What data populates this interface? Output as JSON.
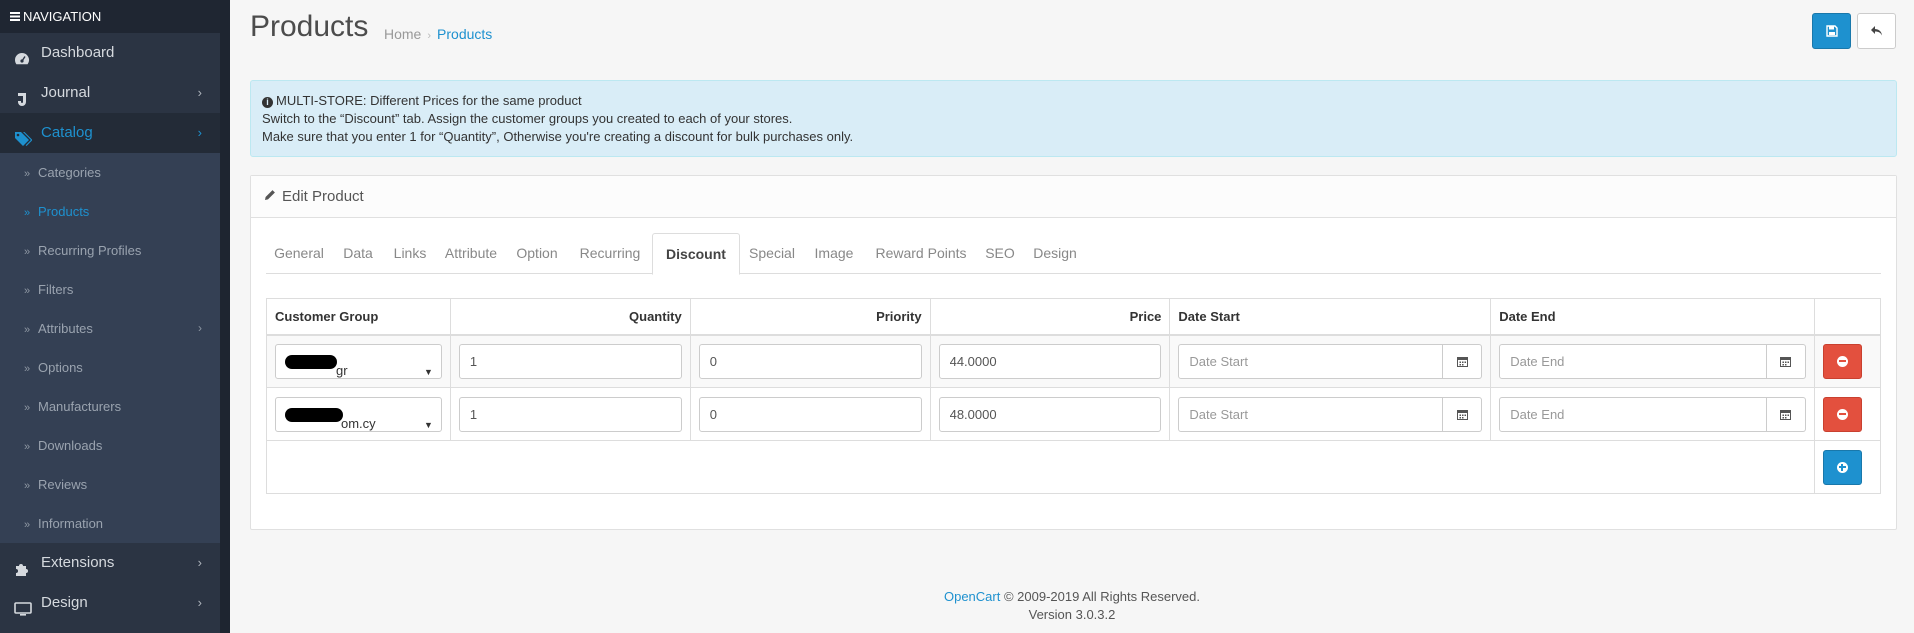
{
  "nav": {
    "header": "NAVIGATION",
    "items": [
      {
        "label": "Dashboard",
        "icon": "dashboard-icon"
      },
      {
        "label": "Journal",
        "icon": "journal-icon"
      },
      {
        "label": "Catalog",
        "icon": "tags-icon"
      }
    ],
    "catalog_sub": [
      {
        "label": "Categories"
      },
      {
        "label": "Products"
      },
      {
        "label": "Recurring Profiles"
      },
      {
        "label": "Filters"
      },
      {
        "label": "Attributes"
      },
      {
        "label": "Options"
      },
      {
        "label": "Manufacturers"
      },
      {
        "label": "Downloads"
      },
      {
        "label": "Reviews"
      },
      {
        "label": "Information"
      }
    ],
    "bottom_items": [
      {
        "label": "Extensions",
        "icon": "puzzle-icon"
      },
      {
        "label": "Design",
        "icon": "monitor-icon"
      }
    ]
  },
  "header": {
    "title": "Products",
    "breadcrumb": [
      "Home",
      "Products"
    ]
  },
  "alert": {
    "line1": "MULTI-STORE: Different Prices for the same product",
    "line2": "Switch to the “Discount” tab. Assign the customer groups you created to each of your stores.",
    "line3": "Make sure that you enter 1 for “Quantity”, Otherwise you're creating a discount for bulk purchases only."
  },
  "panel": {
    "title": "Edit Product",
    "tabs": [
      "General",
      "Data",
      "Links",
      "Attribute",
      "Option",
      "Recurring",
      "Discount",
      "Special",
      "Image",
      "Reward Points",
      "SEO",
      "Design"
    ],
    "active_tab": "Discount"
  },
  "table": {
    "headers": [
      "Customer Group",
      "Quantity",
      "Priority",
      "Price",
      "Date Start",
      "Date End"
    ],
    "rows": [
      {
        "group_suffix": "gr",
        "quantity": "1",
        "priority": "0",
        "price": "44.0000",
        "date_start_ph": "Date Start",
        "date_end_ph": "Date End"
      },
      {
        "group_suffix": "om.cy",
        "quantity": "1",
        "priority": "0",
        "price": "48.0000",
        "date_start_ph": "Date Start",
        "date_end_ph": "Date End"
      }
    ]
  },
  "footer": {
    "brand": "OpenCart",
    "copyright": "© 2009-2019 All Rights Reserved.",
    "version": "Version 3.0.3.2"
  },
  "colors": {
    "accent": "#1e91cf",
    "danger": "#e3503e",
    "sidebar": "#2b3443",
    "alert_bg": "#d9edf7"
  }
}
